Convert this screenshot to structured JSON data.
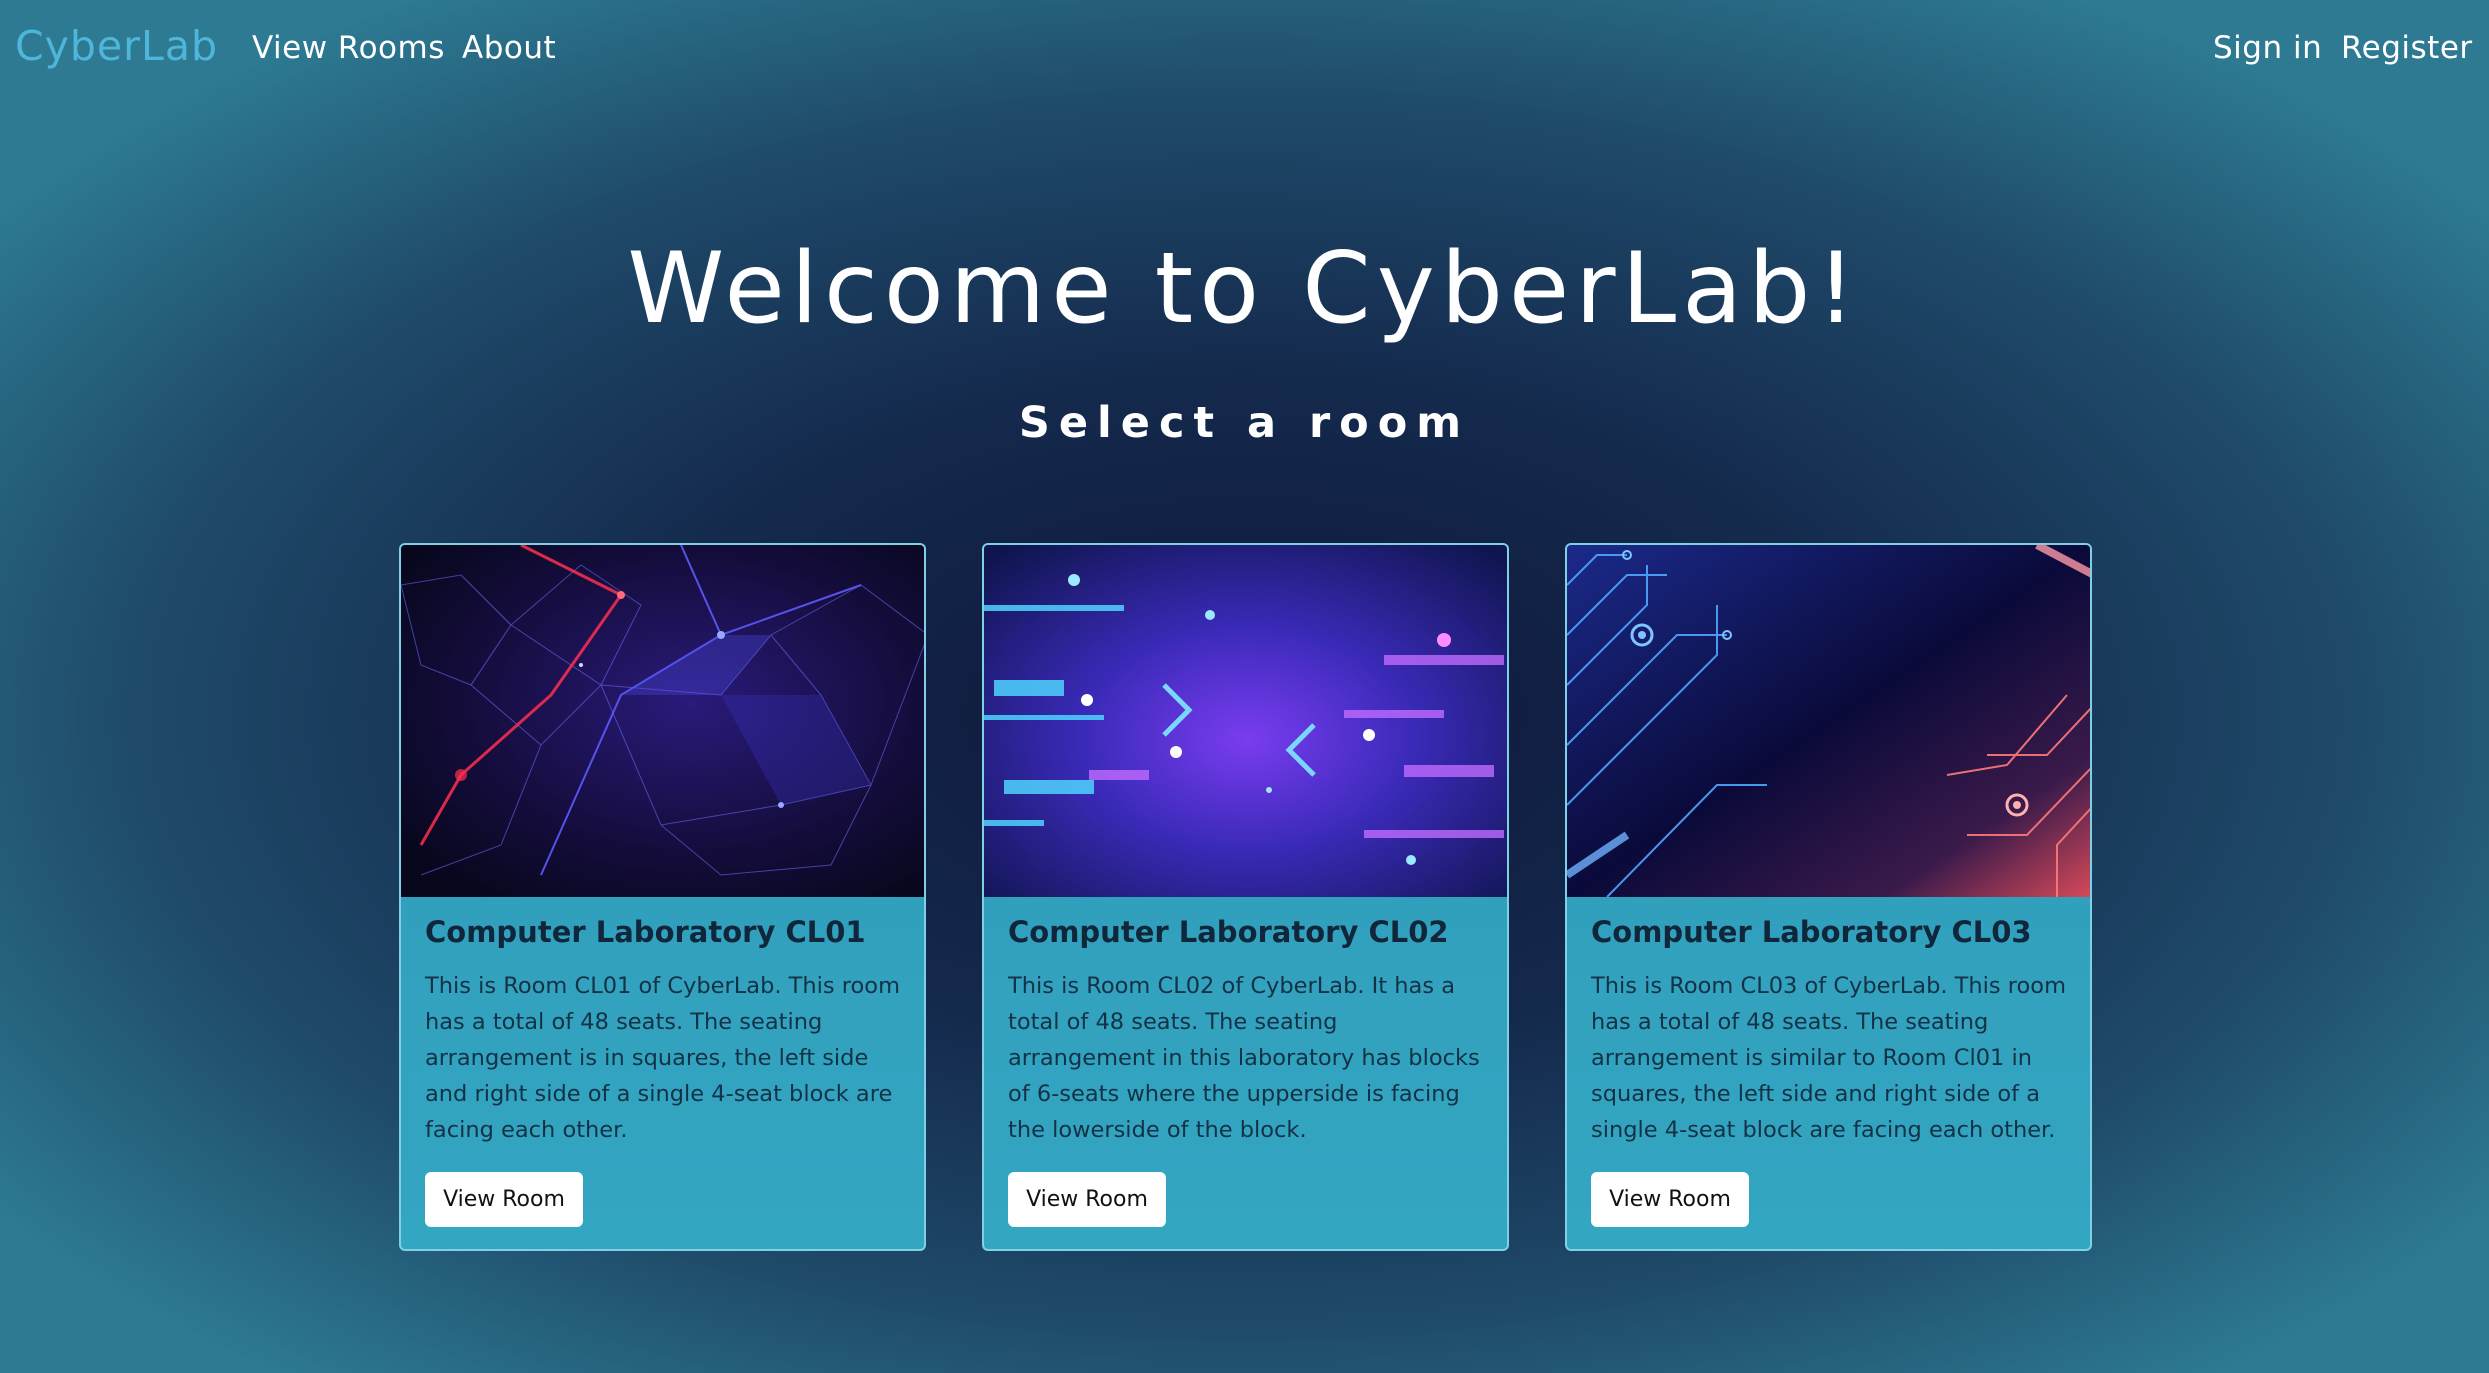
{
  "nav": {
    "brand": "CyberLab",
    "links": [
      "View Rooms",
      "About"
    ],
    "auth": {
      "sign_in": "Sign in",
      "register": "Register"
    }
  },
  "hero": {
    "title": "Welcome to CyberLab!",
    "subtitle": "Select a room"
  },
  "cards": [
    {
      "title": "Computer Laboratory CL01",
      "text": "This is Room CL01 of CyberLab. This room has a total of 48 seats. The seating arrangement is in squares, the left side and right side of a single 4-seat block are facing each other.",
      "button": "View Room"
    },
    {
      "title": "Computer Laboratory CL02",
      "text": "This is Room CL02 of CyberLab. It has a total of 48 seats. The seating arrangement in this laboratory has blocks of 6-seats where the upperside is facing the lowerside of the block.",
      "button": "View Room"
    },
    {
      "title": "Computer Laboratory CL03",
      "text": "This is Room CL03 of CyberLab. This room has a total of 48 seats. The seating arrangement is similar to Room Cl01 in squares, the left side and right side of a single 4-seat block are facing each other.",
      "button": "View Room"
    }
  ],
  "colors": {
    "brand": "#4fb6db",
    "card_bg": "#33a6c2",
    "card_border": "#7fd0e4",
    "bg_center": "#0e1638",
    "bg_edge": "#2d7a92"
  }
}
